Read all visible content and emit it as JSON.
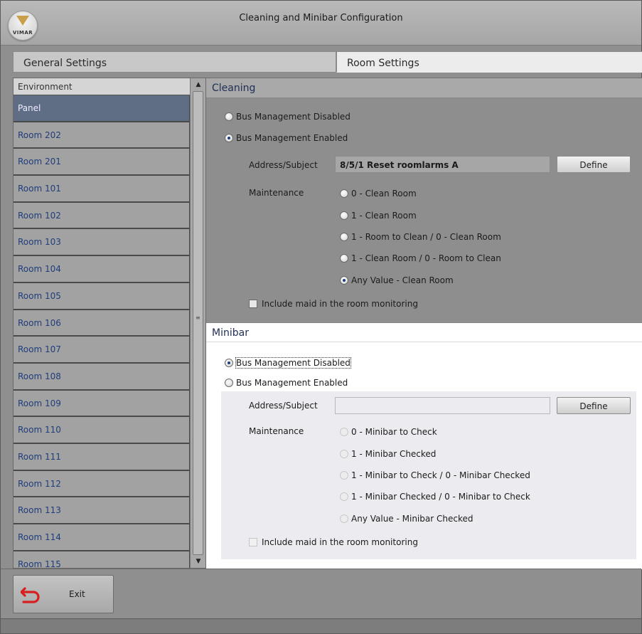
{
  "window": {
    "title": "Cleaning and Minibar Configuration",
    "logo_text": "VIMAR"
  },
  "tabs": {
    "general": "General Settings",
    "room": "Room Settings"
  },
  "environment": {
    "header": "Environment",
    "items": [
      "Panel",
      "Room 202",
      "Room 201",
      "Room 101",
      "Room 102",
      "Room 103",
      "Room 104",
      "Room 105",
      "Room 106",
      "Room 107",
      "Room 108",
      "Room 109",
      "Room 110",
      "Room 111",
      "Room 112",
      "Room 113",
      "Room 114",
      "Room 115"
    ],
    "selected": "Panel"
  },
  "cleaning": {
    "title": "Cleaning",
    "bus_disabled": "Bus Management Disabled",
    "bus_enabled": "Bus Management Enabled",
    "address_label": "Address/Subject",
    "address_value": "8/5/1 Reset roomlarms A",
    "define": "Define",
    "maintenance_label": "Maintenance",
    "options": [
      "0 - Clean Room",
      "1 - Clean Room",
      "1 - Room to Clean / 0 - Clean Room",
      "1 - Clean Room / 0 - Room to Clean",
      "Any Value - Clean Room"
    ],
    "selected_option": "Any Value - Clean Room",
    "include_maid": "Include maid in the room monitoring"
  },
  "minibar": {
    "title": "Minibar",
    "bus_disabled": "Bus Management Disabled",
    "bus_enabled": "Bus Management Enabled",
    "address_label": "Address/Subject",
    "address_value": "",
    "define": "Define",
    "maintenance_label": "Maintenance",
    "options": [
      "0 - Minibar to Check",
      "1 - Minibar Checked",
      "1 - Minibar to Check / 0 - Minibar Checked",
      "1 - Minibar Checked / 0 - Minibar to Check",
      "Any Value - Minibar Checked"
    ],
    "include_maid": "Include maid in the room monitoring"
  },
  "footer": {
    "exit": "Exit"
  },
  "colors": {
    "accent": "#1f2e55",
    "selected_row": "#5f6d85",
    "exit_icon": "#d81e1e"
  }
}
